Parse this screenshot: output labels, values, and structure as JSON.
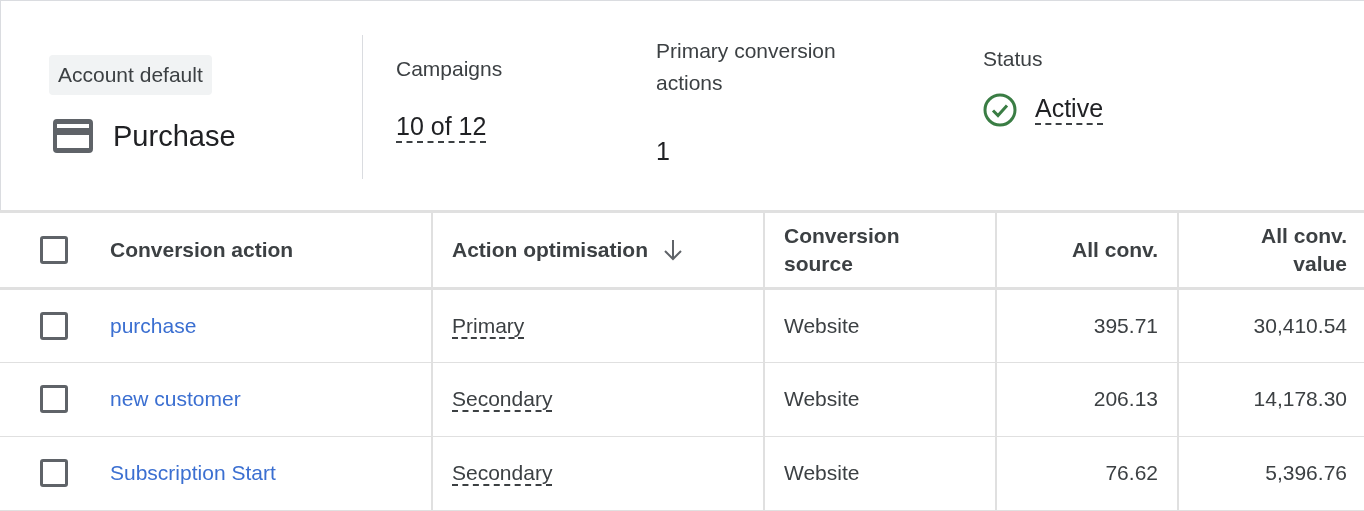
{
  "summary": {
    "chip": "Account default",
    "title": "Purchase",
    "metrics": [
      {
        "kind": "link",
        "label": "Campaigns",
        "value": "10 of 12"
      },
      {
        "kind": "plain",
        "label": "Primary conversion actions",
        "value": "1"
      },
      {
        "kind": "status",
        "label": "Status",
        "value": "Active"
      }
    ]
  },
  "table": {
    "header_checked": false,
    "columns": [
      {
        "label": "Conversion action",
        "kind": "text",
        "sorted": false
      },
      {
        "label": "Action optimisation",
        "kind": "text",
        "sorted": true
      },
      {
        "label": "Conversion source",
        "kind": "text",
        "sorted": false
      },
      {
        "label": "All conv.",
        "kind": "number",
        "sorted": false
      },
      {
        "label": "All conv. value",
        "kind": "number",
        "sorted": false
      }
    ],
    "rows": [
      {
        "checked": false,
        "name": "purchase",
        "optimisation": "Primary",
        "source": "Website",
        "all_conv": "395.71",
        "all_conv_value": "30,410.54"
      },
      {
        "checked": false,
        "name": "new customer",
        "optimisation": "Secondary",
        "source": "Website",
        "all_conv": "206.13",
        "all_conv_value": "14,178.30"
      },
      {
        "checked": false,
        "name": "Subscription Start",
        "optimisation": "Secondary",
        "source": "Website",
        "all_conv": "76.62",
        "all_conv_value": "5,396.76"
      }
    ]
  }
}
